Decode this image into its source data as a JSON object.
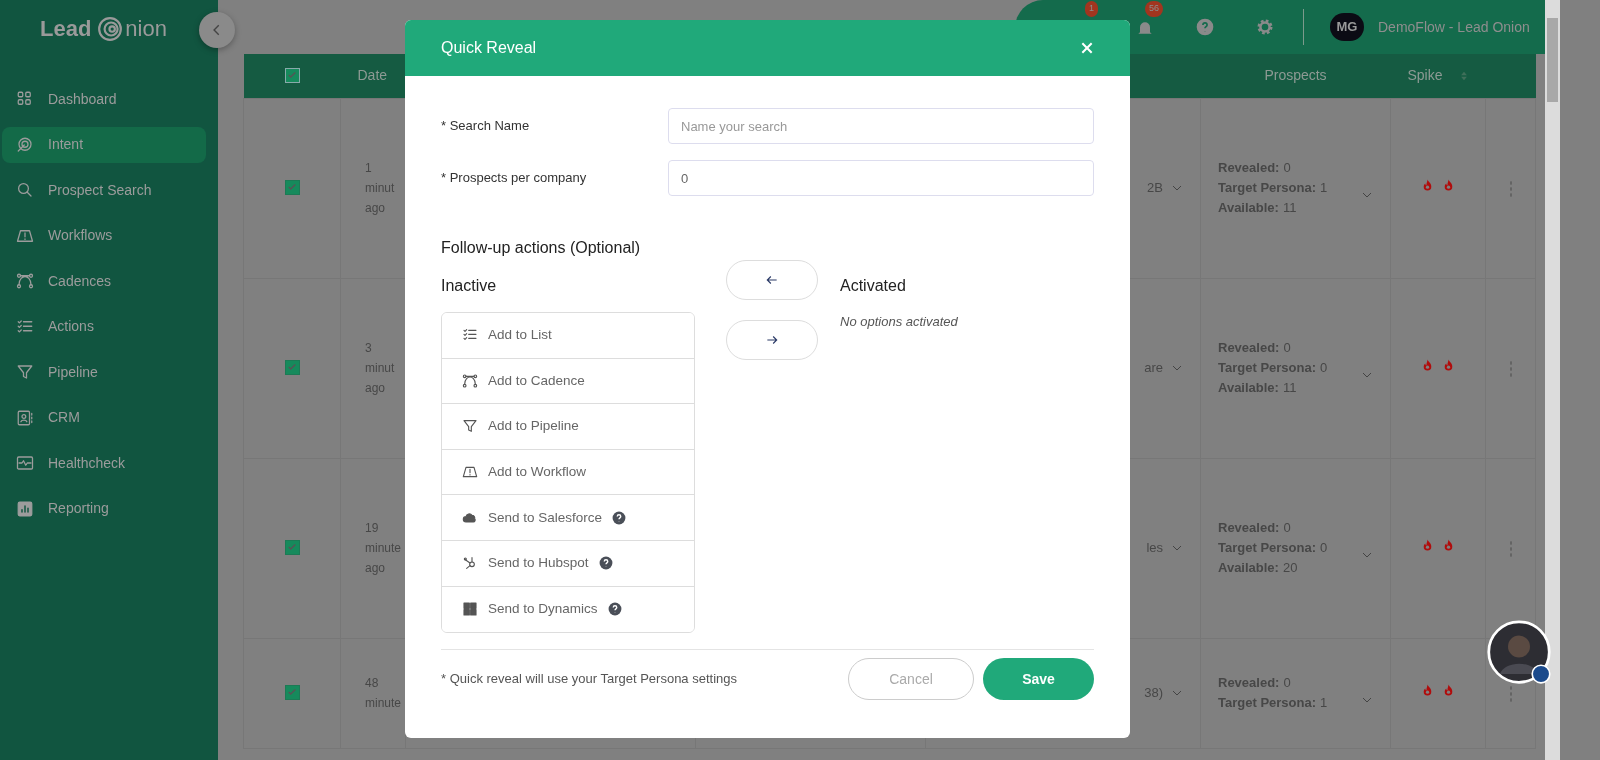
{
  "sidebar": {
    "logo_left": "Lead",
    "logo_right": "nion",
    "items": [
      {
        "label": "Dashboard",
        "kind": "grid",
        "selected": false
      },
      {
        "label": "Intent",
        "kind": "target",
        "selected": true
      },
      {
        "label": "Prospect Search",
        "kind": "search",
        "selected": false
      },
      {
        "label": "Workflows",
        "kind": "road",
        "selected": false
      },
      {
        "label": "Cadences",
        "kind": "nodes",
        "selected": false
      },
      {
        "label": "Actions",
        "kind": "checklist",
        "selected": false
      },
      {
        "label": "Pipeline",
        "kind": "funnel",
        "selected": false
      },
      {
        "label": "CRM",
        "kind": "contact",
        "selected": false
      },
      {
        "label": "Healthcheck",
        "kind": "pulse",
        "selected": false
      },
      {
        "label": "Reporting",
        "kind": "chart",
        "selected": false
      }
    ]
  },
  "topbar": {
    "badges": [
      {
        "kind": "message",
        "count": "1"
      },
      {
        "kind": "bell",
        "count": "56"
      }
    ],
    "initials": "MG",
    "account": "DemoFlow - Lead Onion"
  },
  "table": {
    "header_checked": true,
    "columns": [
      "Date",
      "Prospects",
      "Spike"
    ],
    "rows": [
      {
        "checked": true,
        "date": [
          "1 minut",
          "ago"
        ],
        "column_5": [
          "2B"
        ],
        "prospects": [
          {
            "label": "Revealed:",
            "value": "0"
          },
          {
            "label": "Target Persona:",
            "value": "1"
          },
          {
            "label": "Available:",
            "value": "11"
          }
        ]
      },
      {
        "checked": true,
        "date": [
          "3 minut",
          "ago"
        ],
        "column_5": [
          "are"
        ],
        "prospects": [
          {
            "label": "Revealed:",
            "value": "0"
          },
          {
            "label": "Target Persona:",
            "value": "0"
          },
          {
            "label": "Available:",
            "value": "11"
          }
        ]
      },
      {
        "checked": true,
        "date": [
          "19",
          "minute",
          "ago"
        ],
        "column_5": [
          "les"
        ],
        "prospects": [
          {
            "label": "Revealed:",
            "value": "0"
          },
          {
            "label": "Target Persona:",
            "value": "0"
          },
          {
            "label": "Available:",
            "value": "20"
          }
        ]
      },
      {
        "checked": true,
        "date": [
          "48",
          "minute"
        ],
        "column_5": [
          "38)"
        ],
        "prospects": [
          {
            "label": "Revealed:",
            "value": "0"
          },
          {
            "label": "Target Persona:",
            "value": "1"
          }
        ]
      }
    ]
  },
  "modal": {
    "title": "Quick Reveal",
    "fields": [
      {
        "label": "* Search Name",
        "placeholder": "Name your search"
      },
      {
        "label": "* Prospects per company",
        "value": "0"
      }
    ],
    "section_title": "Follow-up actions (Optional)",
    "inactive_title": "Inactive",
    "activated_title": "Activated",
    "activated_empty": "No options activated",
    "inactive": [
      {
        "label": "Add to List",
        "kind": "checklist",
        "help": false
      },
      {
        "label": "Add to Cadence",
        "kind": "nodes",
        "help": false
      },
      {
        "label": "Add to Pipeline",
        "kind": "funnel",
        "help": false
      },
      {
        "label": "Add to Workflow",
        "kind": "road",
        "help": false
      },
      {
        "label": "Send to Salesforce",
        "kind": "cloud",
        "help": true
      },
      {
        "label": "Send to Hubspot",
        "kind": "sprocket",
        "help": true
      },
      {
        "label": "Send to Dynamics",
        "kind": "squares",
        "help": true
      }
    ],
    "note": "* Quick reveal will use your Target Persona settings",
    "cancel": "Cancel",
    "save": "Save"
  }
}
